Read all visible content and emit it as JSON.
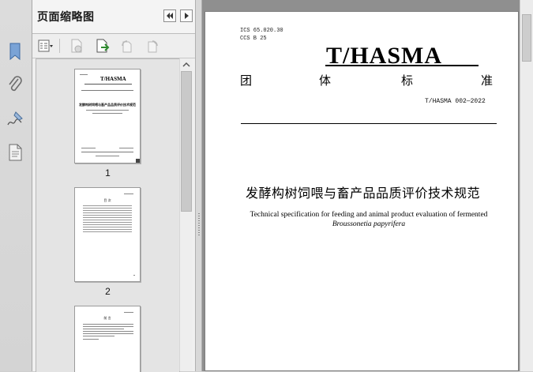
{
  "left_strip": {
    "icons": [
      "bookmark-icon",
      "paperclip-icon",
      "signature-icon",
      "page-icon"
    ]
  },
  "panel": {
    "title": "页面缩略图",
    "prev_button": "◀◀",
    "next_button": "▶",
    "toolbar_icons": [
      "options-menu-icon",
      "delete-page-icon",
      "extract-page-icon",
      "rotate-ccw-icon",
      "rotate-cw-icon"
    ]
  },
  "thumbnails": [
    {
      "label": "1",
      "mini_logo": "T/HASMA",
      "mini_title": "发酵构树饲喂与畜产品品质评价技术规范"
    },
    {
      "label": "2",
      "mini_logo": "",
      "mini_title": "目 次"
    },
    {
      "label": "",
      "mini_logo": "",
      "mini_title": "前 言"
    }
  ],
  "document": {
    "ics": "ICS  65.020.30",
    "ccs": "CCS  B 25",
    "logo": "T/HASMA",
    "standard_chars": [
      "团",
      "体",
      "标",
      "准"
    ],
    "standard_number": "T/HASMA 002—2022",
    "title_zh": "发酵构树饲喂与畜产品品质评价技术规范",
    "title_en_line1": "Technical specification for feeding and animal product evaluation of fermented",
    "title_en_line2": "Broussonetia papyrifera"
  }
}
